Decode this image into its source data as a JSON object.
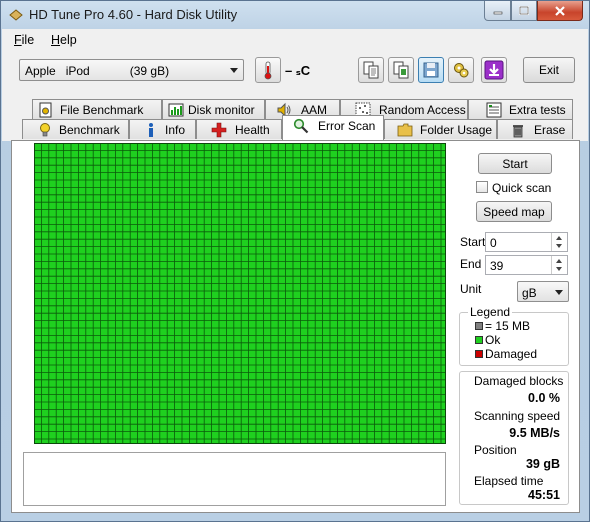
{
  "window": {
    "title": "HD Tune Pro 4.60 - Hard Disk Utility"
  },
  "menu": {
    "file": {
      "accel": "F",
      "rest": "ile"
    },
    "help": {
      "accel": "H",
      "rest": "elp"
    }
  },
  "toolbar": {
    "drive": "Apple   iPod            (39 gB)",
    "temperature": "– ₛC",
    "exit_label": "Exit",
    "icons": [
      "copy-text-icon",
      "copy-screenshot-icon",
      "save-icon",
      "settings-icon",
      "download-icon"
    ]
  },
  "tabs": {
    "top_row": [
      {
        "label": "File Benchmark",
        "icon": "file-benchmark-icon"
      },
      {
        "label": "Disk monitor",
        "icon": "disk-monitor-icon"
      },
      {
        "label": "AAM",
        "icon": "speaker-icon"
      },
      {
        "label": "Random Access",
        "icon": "random-access-icon"
      },
      {
        "label": "Extra tests",
        "icon": "extra-tests-icon"
      }
    ],
    "bottom_row": [
      {
        "label": "Benchmark",
        "icon": "lightbulb-icon"
      },
      {
        "label": "Info",
        "icon": "info-icon"
      },
      {
        "label": "Health",
        "icon": "health-cross-icon"
      },
      {
        "label": "Error Scan",
        "icon": "magnifier-icon",
        "selected": true
      },
      {
        "label": "Folder Usage",
        "icon": "folder-icon"
      },
      {
        "label": "Erase",
        "icon": "trash-icon"
      }
    ]
  },
  "scan": {
    "start_button": "Start",
    "quick_scan_label": "Quick scan",
    "quick_scan_checked": false,
    "speed_map_button": "Speed map",
    "start_label": "Start",
    "start_value": "0",
    "end_label": "End",
    "end_value": "39",
    "unit_label": "Unit",
    "unit_value": "gB",
    "grid_status": "ok",
    "grid_ok_color": "#1fd01f"
  },
  "legend": {
    "title": "Legend",
    "block_size": "= 15 MB",
    "ok": "Ok",
    "damaged": "Damaged",
    "colors": {
      "block": "#808080",
      "ok": "#1fd01f",
      "damaged": "#cc0000"
    }
  },
  "stats": {
    "damaged_blocks_label": "Damaged blocks",
    "damaged_blocks_value": "0.0 %",
    "scanning_speed_label": "Scanning speed",
    "scanning_speed_value": "9.5 MB/s",
    "position_label": "Position",
    "position_value": "39 gB",
    "elapsed_label": "Elapsed time",
    "elapsed_value": "45:51"
  }
}
